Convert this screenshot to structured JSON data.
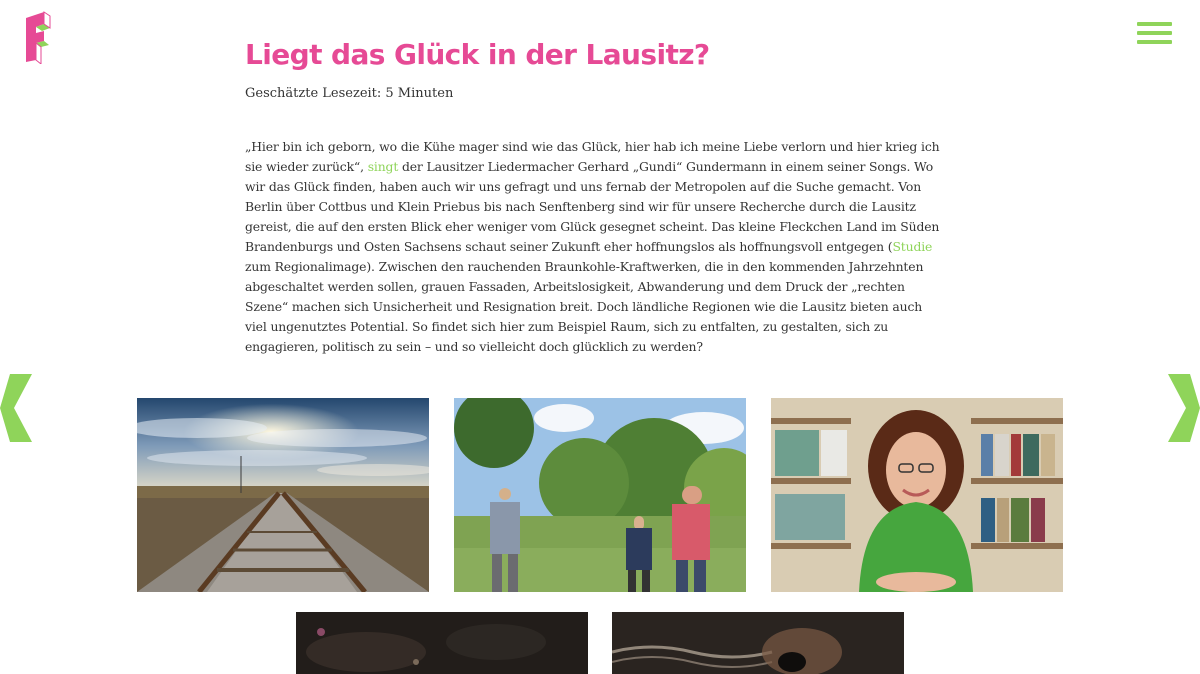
{
  "header": {
    "logo_icon": "brand-logo-icon",
    "menu_icon": "hamburger-menu-icon"
  },
  "article": {
    "title": "Liegt das Glück in der Lausitz?",
    "reading_time": "Geschätzte Lesezeit: 5 Minuten",
    "paragraph": [
      "„Hier bin ich geborn, wo die Kühe mager sind wie das Glück, hier hab ich meine Liebe verlorn und hier krieg ich sie wieder zurück“, ",
      "singt",
      " der Lausitzer Liedermacher Gerhard „Gundi“ Gundermann in einem seiner Songs. Wo wir das Glück finden, haben auch wir uns gefragt und uns fernab der Metropolen auf die Suche gemacht. Von Berlin über Cottbus und Klein Priebus bis nach Senftenberg sind wir für unsere Recherche durch die Lausitz gereist, die auf den ersten Blick eher weniger vom Glück gesegnet scheint. Das kleine Fleckchen Land im Süden Brandenburgs und Osten Sachsens schaut seiner Zukunft eher hoffnungslos als hoffnungsvoll entgegen (",
      "Studie",
      " zum Regionalimage). Zwischen den rauchenden Braunkohle-Kraftwerken, die in den kommenden Jahrzehnten abgeschaltet werden sollen, grauen Fassaden, Arbeitslosigkeit, Abwanderung und dem Druck der „rechten Szene“ machen sich Unsicherheit und Resignation breit. Doch ländliche Regionen wie die Lausitz bieten auch viel ungenutztes Potential. So findet sich hier zum Beispiel Raum, sich zu entfalten, zu gestalten, sich zu engagieren, politisch zu sein – und so vielleicht doch glücklich zu werden?"
    ]
  },
  "nav": {
    "prev_icon": "chevron-left-icon",
    "next_icon": "chevron-right-icon"
  },
  "gallery": {
    "photos": [
      "railway-tracks",
      "garden-conversation",
      "woman-portrait",
      "dark-photo",
      "dark-photo-hands"
    ]
  },
  "colors": {
    "accent_pink": "#e64a95",
    "accent_green": "#8fd45a",
    "text": "#333333"
  }
}
